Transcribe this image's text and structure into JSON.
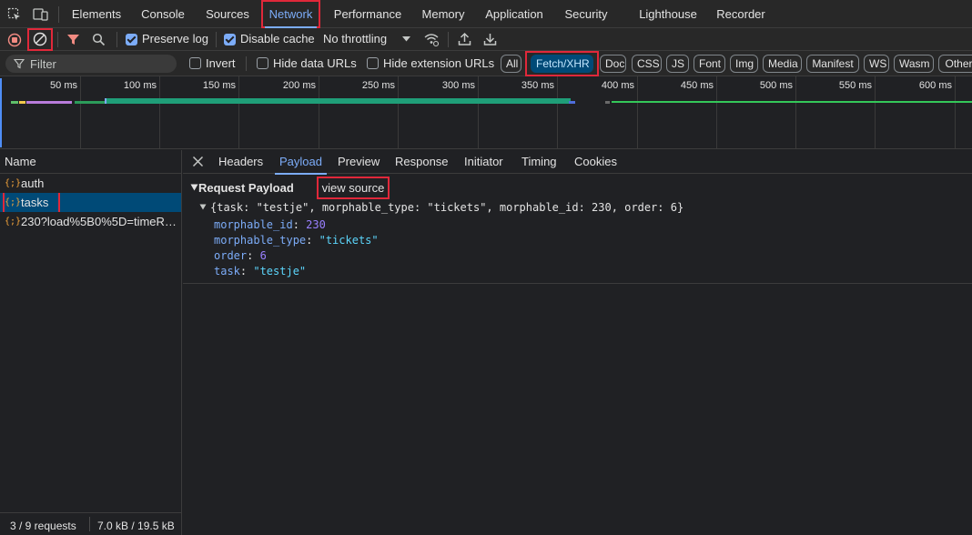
{
  "tabs": [
    {
      "label": "Elements"
    },
    {
      "label": "Console"
    },
    {
      "label": "Sources"
    },
    {
      "label": "Network"
    },
    {
      "label": "Performance"
    },
    {
      "label": "Memory"
    },
    {
      "label": "Application"
    },
    {
      "label": "Security"
    },
    {
      "label": "Lighthouse"
    },
    {
      "label": "Recorder"
    }
  ],
  "toolbar": {
    "preserve_log_label": "Preserve log",
    "preserve_log_checked": true,
    "disable_cache_label": "Disable cache",
    "disable_cache_checked": true,
    "throttling": "No throttling"
  },
  "filter": {
    "placeholder": "Filter",
    "invert_label": "Invert",
    "hide_data_urls_label": "Hide data URLs",
    "hide_extension_urls_label": "Hide extension URLs",
    "types": [
      "All",
      "Fetch/XHR",
      "Doc",
      "CSS",
      "JS",
      "Font",
      "Img",
      "Media",
      "Manifest",
      "WS",
      "Wasm",
      "Other"
    ],
    "active_type": "Fetch/XHR"
  },
  "timeline": {
    "ticks": [
      "50 ms",
      "100 ms",
      "150 ms",
      "200 ms",
      "250 ms",
      "300 ms",
      "350 ms",
      "400 ms",
      "450 ms",
      "500 ms",
      "550 ms",
      "600 ms"
    ]
  },
  "requests": {
    "header": "Name",
    "items": [
      {
        "name": "auth"
      },
      {
        "name": "tasks"
      },
      {
        "name": "230?load%5B0%5D=timeRe..."
      }
    ],
    "selected": "tasks"
  },
  "status": {
    "requests": "3 / 9 requests",
    "transferred": "7.0 kB / 19.5 kB"
  },
  "detail": {
    "tabs": [
      "Headers",
      "Payload",
      "Preview",
      "Response",
      "Initiator",
      "Timing",
      "Cookies"
    ],
    "active_tab": "Payload",
    "section_title": "Request Payload",
    "view_source_label": "view source",
    "summary": "{task: \"testje\", morphable_type: \"tickets\", morphable_id: 230, order: 6}",
    "fields": [
      {
        "key": "morphable_id",
        "value": "230",
        "type": "number"
      },
      {
        "key": "morphable_type",
        "value": "\"tickets\"",
        "type": "string"
      },
      {
        "key": "order",
        "value": "6",
        "type": "number"
      },
      {
        "key": "task",
        "value": "\"testje\"",
        "type": "string"
      }
    ]
  },
  "colors": {
    "accent": "#7cacf8",
    "highlight": "#e0283a",
    "selected_row": "#004a77"
  },
  "icons": [
    "select-element-icon",
    "device-toolbar-icon",
    "record-stop-icon",
    "clear-icon",
    "filter-icon",
    "search-icon",
    "network-conditions-icon",
    "import-har-icon",
    "export-har-icon",
    "close-icon",
    "xhr-icon"
  ]
}
